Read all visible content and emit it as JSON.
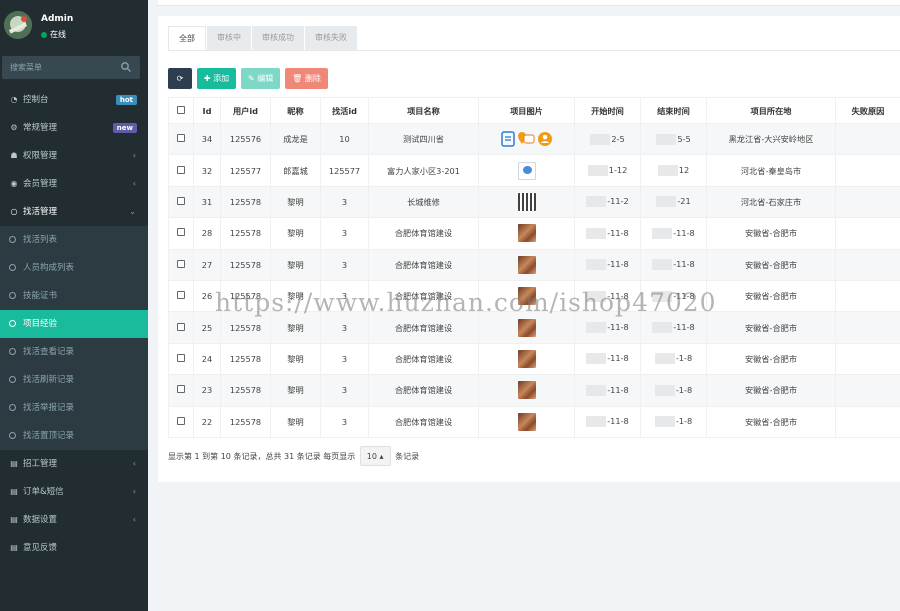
{
  "user": {
    "name": "Admin",
    "status": "在线"
  },
  "sidebar": {
    "search_placeholder": "搜索菜单",
    "items": [
      {
        "label": "控制台",
        "icon": "dashboard-icon",
        "badge": "hot"
      },
      {
        "label": "常规管理",
        "icon": "cogs-icon",
        "badge": "new"
      },
      {
        "label": "权限管理",
        "icon": "group-icon",
        "chevron": "‹"
      },
      {
        "label": "会员管理",
        "icon": "user-circle-icon",
        "chevron": "‹"
      },
      {
        "label": "找活管理",
        "icon": "circle-icon",
        "chevron": "⌄"
      }
    ],
    "sub_items": [
      "找活列表",
      "人员构成列表",
      "技能证书",
      "项目经验",
      "找活查看记录",
      "找活刷新记录",
      "找活举报记录",
      "找活置顶记录"
    ],
    "items_after": [
      {
        "label": "招工管理",
        "icon": "list-icon",
        "chevron": "‹"
      },
      {
        "label": "订单&短信",
        "icon": "list-icon",
        "chevron": "‹"
      },
      {
        "label": "数据设置",
        "icon": "list-icon",
        "chevron": "‹"
      },
      {
        "label": "意见反馈",
        "icon": "list-icon"
      }
    ]
  },
  "tabs": [
    "全部",
    "审核中",
    "审核成功",
    "审核失败"
  ],
  "toolbar": {
    "add": "添加",
    "edit": "编辑",
    "delete": "删除"
  },
  "table": {
    "headers": [
      "Id",
      "用户id",
      "昵称",
      "找活id",
      "项目名称",
      "项目图片",
      "开始时间",
      "结束时间",
      "项目所在地",
      "失败原因"
    ],
    "rows": [
      {
        "id": "34",
        "uid": "125576",
        "nick": "成龙是",
        "fid": "10",
        "name": "测试四川省",
        "img": "icons",
        "start": "2-5",
        "end": "5-5",
        "loc": "黑龙江省-大兴安岭地区",
        "reason": ""
      },
      {
        "id": "32",
        "uid": "125577",
        "nick": "郎嘉城",
        "fid": "125577",
        "name": "富力人家小区3-201",
        "img": "logo",
        "start": "1-12",
        "end": "12",
        "loc": "河北省-秦皇岛市",
        "reason": ""
      },
      {
        "id": "31",
        "uid": "125578",
        "nick": "黎明",
        "fid": "3",
        "name": "长城维修",
        "img": "qr",
        "start": "-11-2",
        "end": "-21",
        "loc": "河北省-石家庄市",
        "reason": ""
      },
      {
        "id": "28",
        "uid": "125578",
        "nick": "黎明",
        "fid": "3",
        "name": "合肥体育馆建设",
        "img": "photo",
        "start": "-11-8",
        "end": "-11-8",
        "loc": "安徽省-合肥市",
        "reason": ""
      },
      {
        "id": "27",
        "uid": "125578",
        "nick": "黎明",
        "fid": "3",
        "name": "合肥体育馆建设",
        "img": "photo",
        "start": "-11-8",
        "end": "-11-8",
        "loc": "安徽省-合肥市",
        "reason": ""
      },
      {
        "id": "26",
        "uid": "125578",
        "nick": "黎明",
        "fid": "3",
        "name": "合肥体育馆建设",
        "img": "photo",
        "start": "-11-8",
        "end": "-11-8",
        "loc": "安徽省-合肥市",
        "reason": ""
      },
      {
        "id": "25",
        "uid": "125578",
        "nick": "黎明",
        "fid": "3",
        "name": "合肥体育馆建设",
        "img": "photo",
        "start": "-11-8",
        "end": "-11-8",
        "loc": "安徽省-合肥市",
        "reason": ""
      },
      {
        "id": "24",
        "uid": "125578",
        "nick": "黎明",
        "fid": "3",
        "name": "合肥体育馆建设",
        "img": "photo",
        "start": "-11-8",
        "end": "-1-8",
        "loc": "安徽省-合肥市",
        "reason": ""
      },
      {
        "id": "23",
        "uid": "125578",
        "nick": "黎明",
        "fid": "3",
        "name": "合肥体育馆建设",
        "img": "photo",
        "start": "-11-8",
        "end": "-1-8",
        "loc": "安徽省-合肥市",
        "reason": ""
      },
      {
        "id": "22",
        "uid": "125578",
        "nick": "黎明",
        "fid": "3",
        "name": "合肥体育馆建设",
        "img": "photo",
        "start": "-11-8",
        "end": "-1-8",
        "loc": "安徽省-合肥市",
        "reason": ""
      }
    ]
  },
  "pager": {
    "before": "显示第 1 到第 10 条记录，总共 31 条记录 每页显示",
    "page_size": "10",
    "after": "条记录"
  },
  "watermark": "https://www.huzhan.com/ishop47020",
  "colors": {
    "sidebar_bg": "#222d32",
    "accent": "#18bc9c",
    "danger": "#f08879",
    "dark": "#2c3e50"
  }
}
